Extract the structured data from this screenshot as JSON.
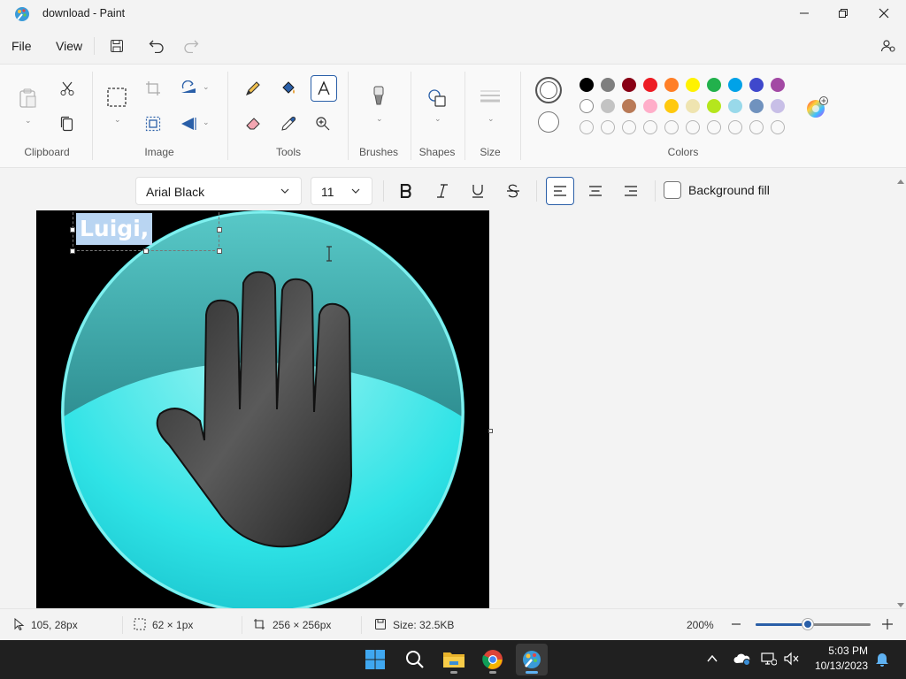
{
  "window": {
    "title": "download - Paint"
  },
  "menu": {
    "file_label": "File",
    "view_label": "View"
  },
  "ribbon": {
    "groups": {
      "clipboard": "Clipboard",
      "image": "Image",
      "tools": "Tools",
      "brushes": "Brushes",
      "shapes": "Shapes",
      "size": "Size",
      "colors": "Colors"
    },
    "colors_row1": [
      "#000000",
      "#7f7f7f",
      "#880015",
      "#ed1c24",
      "#ff7f27",
      "#fff200",
      "#22b14c",
      "#00a2e8",
      "#3f48cc",
      "#a349a4"
    ],
    "colors_row2": [
      "#ffffff",
      "#c3c3c3",
      "#b97a57",
      "#ffaec9",
      "#ffc90e",
      "#efe4b0",
      "#b5e61d",
      "#99d9ea",
      "#7092be",
      "#c8bfe7"
    ]
  },
  "text_toolbar": {
    "font_family": "Arial Black",
    "font_size": "11",
    "background_fill_label": "Background fill"
  },
  "canvas": {
    "text_content": "Luigi,"
  },
  "status": {
    "cursor_pos": "105, 28px",
    "selection_size": "62 × 1px",
    "canvas_size": "256 × 256px",
    "file_size": "Size: 32.5KB",
    "zoom": "200%",
    "zoom_level_fraction": 0.45
  },
  "taskbar": {
    "time": "5:03 PM",
    "date": "10/13/2023"
  }
}
